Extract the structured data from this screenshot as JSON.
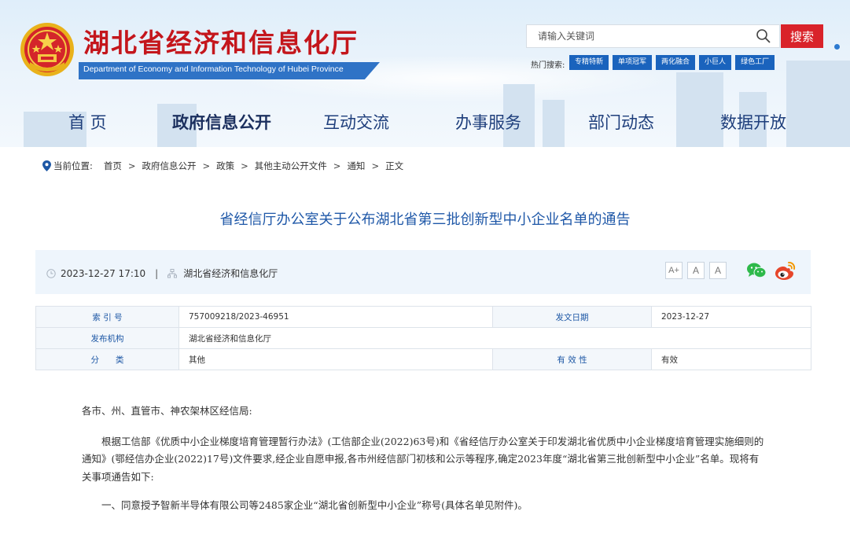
{
  "header": {
    "title": "湖北省经济和信息化厅",
    "subtitle": "Department of Economy and Information Technology of Hubei Province",
    "search_placeholder": "请输入关键词",
    "search_button": "搜索",
    "hot_label": "热门搜索:",
    "hot_tags": [
      "专精特新",
      "单项冠军",
      "两化融合",
      "小巨人",
      "绿色工厂"
    ]
  },
  "nav": {
    "items": [
      "首 页",
      "政府信息公开",
      "互动交流",
      "办事服务",
      "部门动态",
      "数据开放"
    ],
    "active": "政府信息公开"
  },
  "breadcrumb": {
    "label": "当前位置:",
    "items": [
      "首页",
      "政府信息公开",
      "政策",
      "其他主动公开文件",
      "通知",
      "正文"
    ],
    "separator": ">"
  },
  "article": {
    "title": "省经信厅办公室关于公布湖北省第三批创新型中小企业名单的通告",
    "datetime": "2023-12-27 17:10",
    "divider": "|",
    "publisher": "湖北省经济和信息化厅",
    "font_sizes": [
      "A+",
      "A",
      "A"
    ],
    "share": [
      "wechat-icon",
      "weibo-icon"
    ]
  },
  "info_table": {
    "index_label": "索 引 号",
    "index_value": "757009218/2023-46951",
    "date_label": "发文日期",
    "date_value": "2023-12-27",
    "org_label": "发布机构",
    "org_value": "湖北省经济和信息化厅",
    "category_label": "分　　类",
    "category_value": "其他",
    "validity_label": "有 效 性",
    "validity_value": "有效"
  },
  "body": {
    "greeting": "各市、州、直管市、神农架林区经信局:",
    "paragraph1": "根据工信部《优质中小企业梯度培育管理暂行办法》(工信部企业(2022)63号)和《省经信厅办公室关于印发湖北省优质中小企业梯度培育管理实施细则的通知》(鄂经信办企业(2022)17号)文件要求,经企业自愿申报,各市州经信部门初核和公示等程序,确定2023年度“湖北省第三批创新型中小企业”名单。现将有关事项通告如下:",
    "paragraph2": "一、同意授予智新半导体有限公司等2485家企业“湖北省创新型中小企业”称号(具体名单见附件)。"
  },
  "colors": {
    "brand_red": "#c4161c",
    "nav_blue": "#1f3f7c",
    "link_blue": "#1f58a8",
    "tag_blue": "#1a63bd",
    "search_red": "#d9232a"
  }
}
